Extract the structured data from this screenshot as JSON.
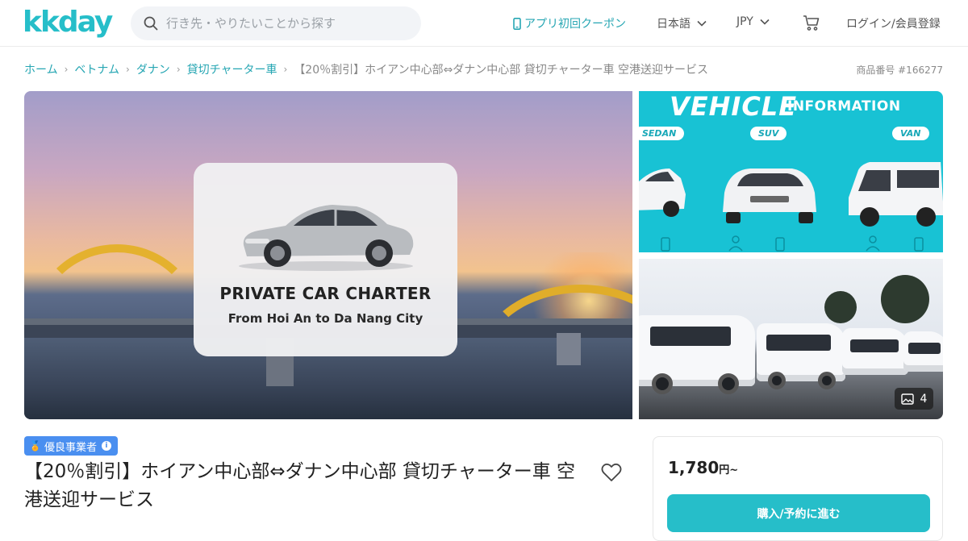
{
  "header": {
    "logo": "kkday",
    "search_placeholder": "行き先・やりたいことから探す",
    "app_coupon": "アプリ初回クーポン",
    "language": "日本語",
    "currency": "JPY",
    "login": "ログイン/会員登録"
  },
  "breadcrumb": {
    "items": [
      "ホーム",
      "ベトナム",
      "ダナン",
      "貸切チャーター車"
    ],
    "current": "【20％割引】ホイアン中心部⇔ダナン中心部 貸切チャーター車 空港送迎サービス"
  },
  "product_number": "商品番号 #166277",
  "hero": {
    "title": "PRIVATE CAR CHARTER",
    "subtitle": "From Hoi An to Da Nang City"
  },
  "vehicle_info": {
    "title": "VEHICLE",
    "subtitle": "INFORMATION",
    "types": [
      "SEDAN",
      "SUV",
      "VAN"
    ]
  },
  "photo_count": "4",
  "badge": "優良事業者",
  "title": "【20％割引】ホイアン中心部⇔ダナン中心部 貸切チャーター車 空港送迎サービス",
  "price": {
    "amount": "1,780",
    "unit": "円~"
  },
  "buy_button": "購入/予約に進む",
  "colors": {
    "brand": "#26bec9",
    "badge": "#4a8ff0",
    "vehicle_banner": "#18c2d4"
  }
}
